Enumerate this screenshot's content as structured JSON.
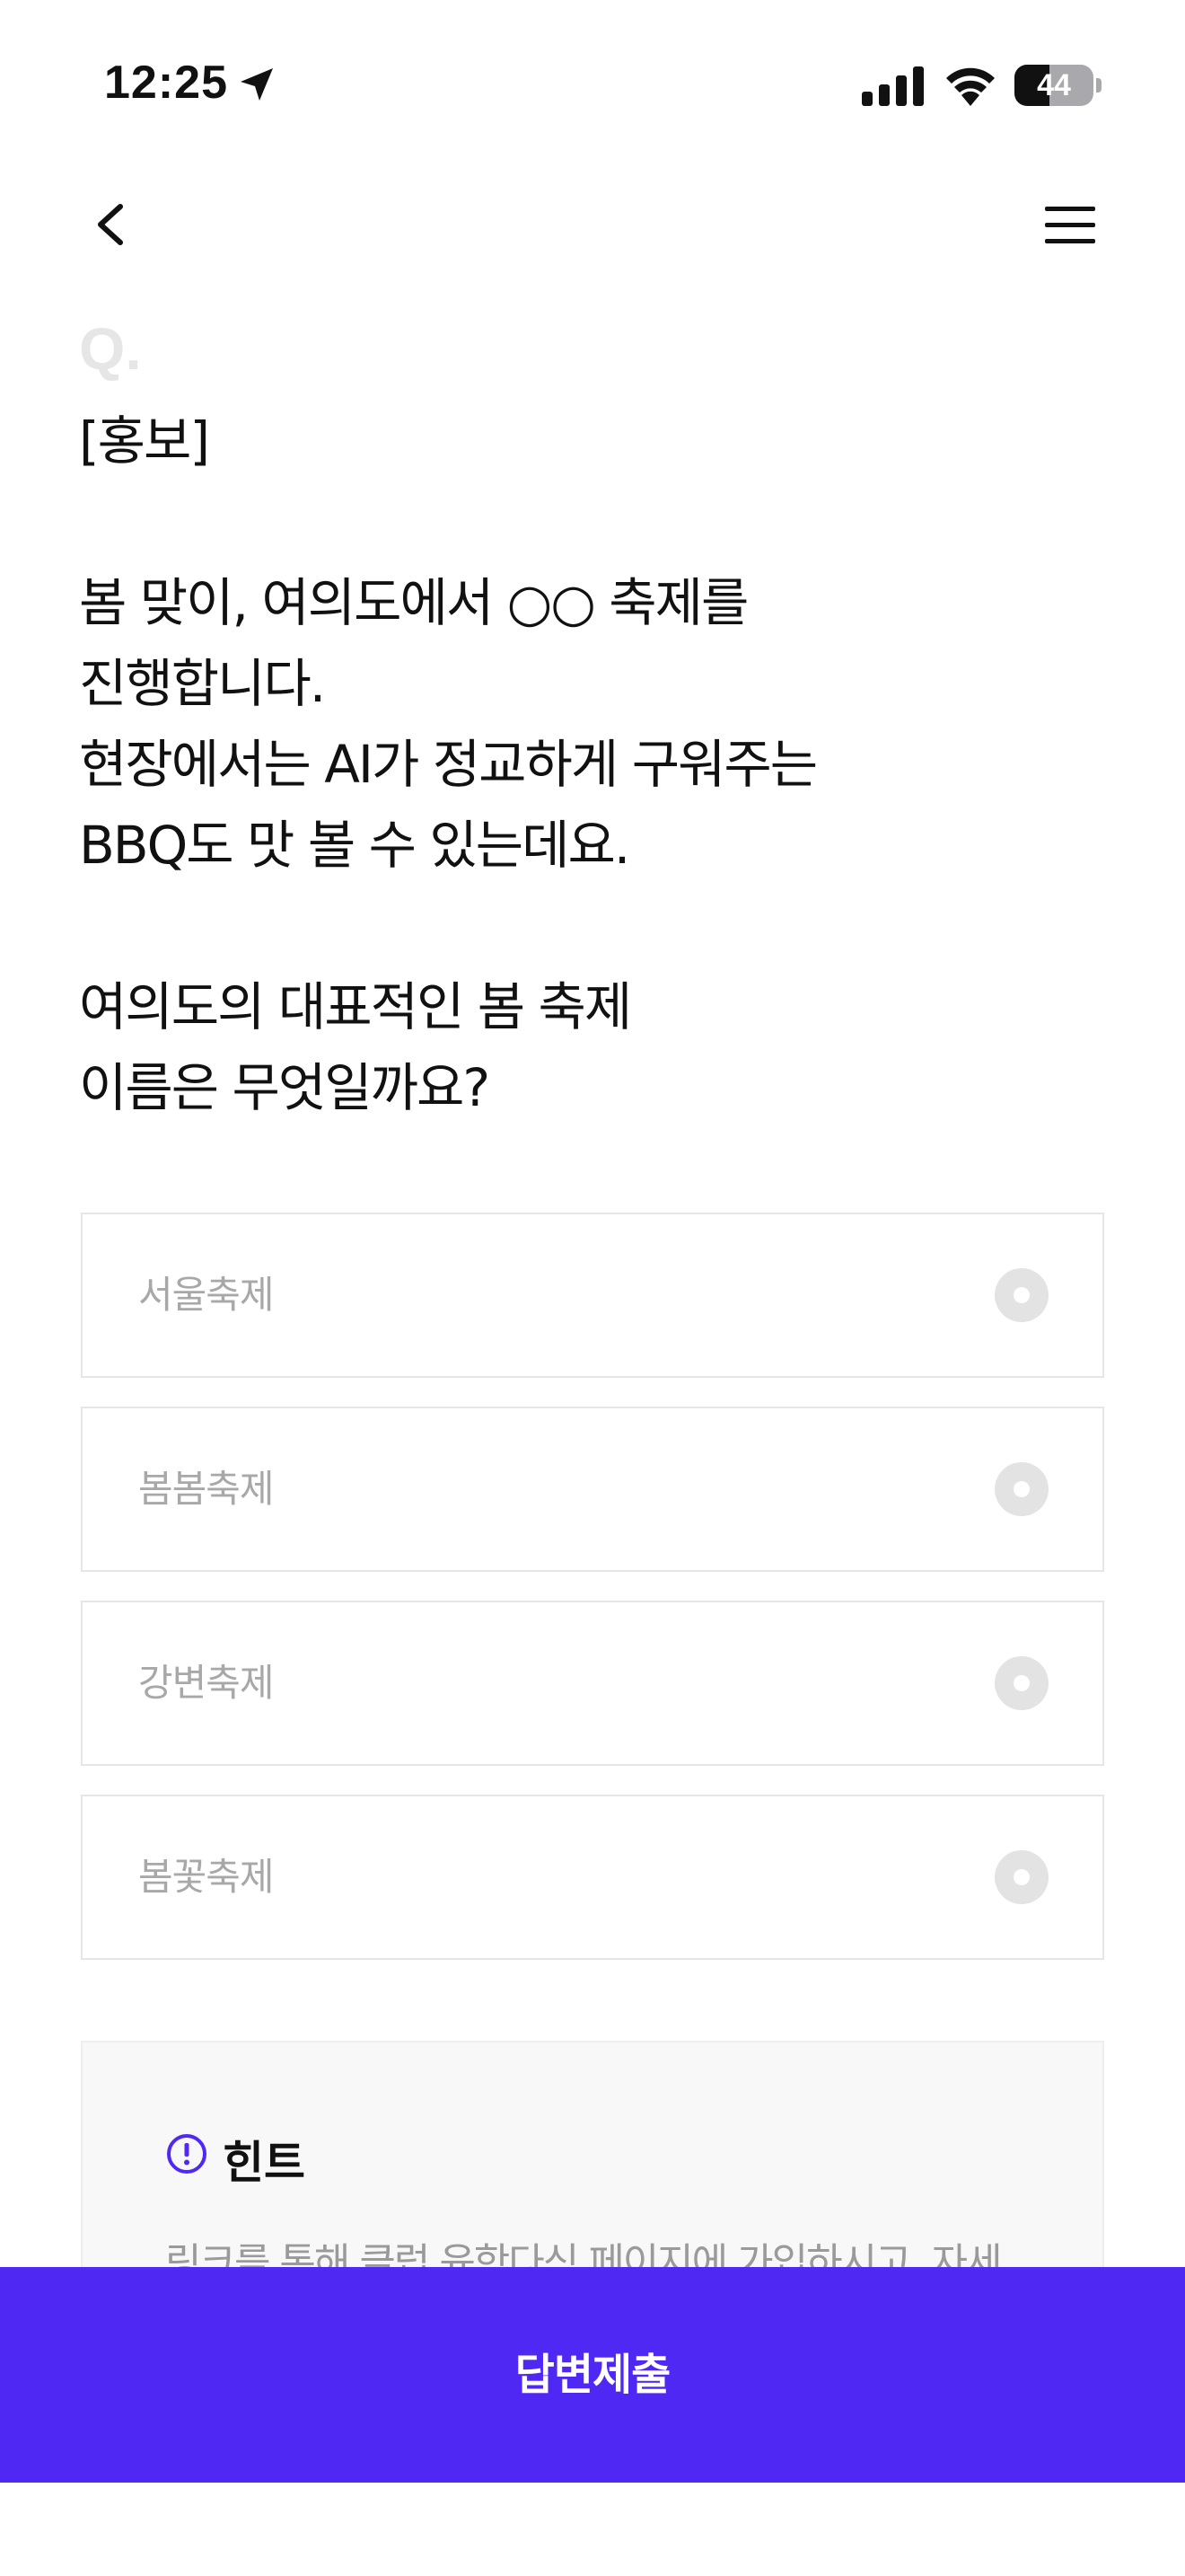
{
  "status_bar": {
    "time": "12:25",
    "battery_level": "44",
    "battery_fraction": 0.44
  },
  "nav": {
    "back_icon": "chevron-left-icon",
    "menu_icon": "hamburger-menu-icon"
  },
  "question": {
    "marker": "Q.",
    "text": "[홍보]\n\n봄 맞이, 여의도에서 ○○ 축제를\n진행합니다.\n현장에서는 AI가 정교하게 구워주는\nBBQ도 맛 볼 수 있는데요.\n\n여의도의 대표적인 봄 축제\n이름은 무엇일까요?"
  },
  "options": [
    {
      "label": "서울축제",
      "selected": false
    },
    {
      "label": "봄봄축제",
      "selected": false
    },
    {
      "label": "강변축제",
      "selected": false
    },
    {
      "label": "봄꽃축제",
      "selected": false
    }
  ],
  "hint": {
    "icon": "exclamation-circle-icon",
    "title": "힌트",
    "text": "링크를 통해 클럽 육학다식 페이지에 가입하시고, 자세"
  },
  "submit": {
    "label": "답변제출"
  },
  "colors": {
    "accent": "#5028f4",
    "option_border": "#e6e6e6",
    "option_text": "#a8a8a8",
    "hint_background": "#f8f8f8"
  }
}
